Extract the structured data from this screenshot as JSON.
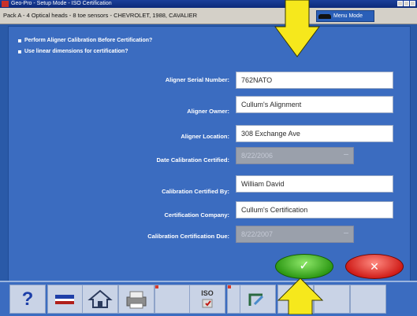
{
  "window": {
    "title": "Geo-Pro - Setup Mode - ISO Certification",
    "vehicle_info": "Pack A - 4 Optical heads - 8 toe sensors - CHEVROLET, 1988, CAVALIER",
    "menu_mode_label": "Menu Mode"
  },
  "options": [
    {
      "label": "Perform Aligner Calibration Before Certification?"
    },
    {
      "label": "Use linear dimensions for certification?"
    }
  ],
  "form": {
    "serial_label": "Aligner Serial Number:",
    "serial_value": "762NATO",
    "owner_label": "Aligner Owner:",
    "owner_value": "Cullum's Alignment",
    "location_label": "Aligner Location:",
    "location_value": "308 Exchange Ave",
    "date_certified_label": "Date Calibration Certified:",
    "date_certified_value": "8/22/2006",
    "certified_by_label": "Calibration Certified By:",
    "certified_by_value": "William David",
    "company_label": "Certification Company:",
    "company_value": "Cullum's Certification",
    "due_label": "Calibration Certification Due:",
    "due_value": "8/22/2007"
  },
  "buttons": {
    "ok_symbol": "✓",
    "cancel_symbol": "✕"
  },
  "toolbar": {
    "help_symbol": "?",
    "iso_label": "ISO"
  },
  "colors": {
    "background": "#3b6cc0",
    "ok": "#2f9a16",
    "cancel": "#d01e1a",
    "arrow": "#f6e81c"
  }
}
